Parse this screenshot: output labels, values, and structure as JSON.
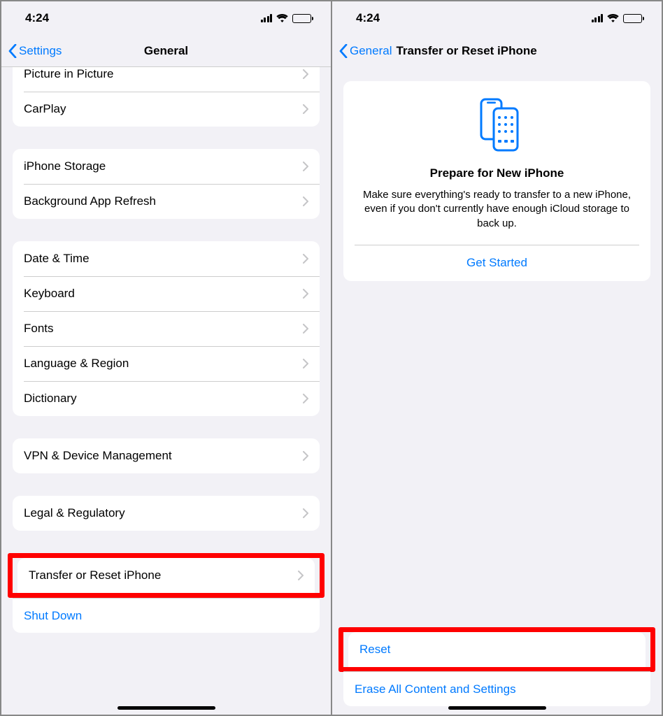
{
  "status": {
    "time": "4:24"
  },
  "colors": {
    "link": "#007aff",
    "highlight": "#ff0000"
  },
  "screenA": {
    "back": "Settings",
    "title": "General",
    "group1": [
      "Picture in Picture",
      "CarPlay"
    ],
    "group2": [
      "iPhone Storage",
      "Background App Refresh"
    ],
    "group3": [
      "Date & Time",
      "Keyboard",
      "Fonts",
      "Language & Region",
      "Dictionary"
    ],
    "group4": [
      "VPN & Device Management"
    ],
    "group5": [
      "Legal & Regulatory"
    ],
    "transfer": "Transfer or Reset iPhone",
    "shutdown": "Shut Down"
  },
  "screenB": {
    "back": "General",
    "title": "Transfer or Reset iPhone",
    "card": {
      "heading": "Prepare for New iPhone",
      "description": "Make sure everything's ready to transfer to a new iPhone, even if you don't currently have enough iCloud storage to back up.",
      "cta": "Get Started"
    },
    "reset": "Reset",
    "erase": "Erase All Content and Settings"
  }
}
